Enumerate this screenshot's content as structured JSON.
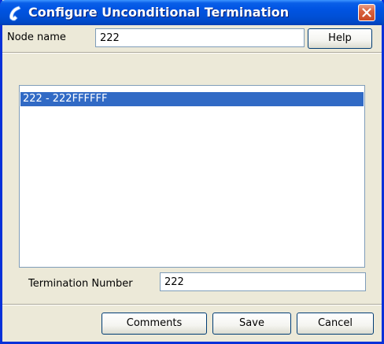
{
  "window": {
    "title": "Configure Unconditional Termination"
  },
  "node": {
    "label": "Node name",
    "value": "222",
    "help_label": "Help"
  },
  "list": {
    "items": [
      {
        "label": "222 - 222FFFFFF",
        "selected": true
      }
    ]
  },
  "termination": {
    "label": "Termination Number",
    "value": "222"
  },
  "buttons": {
    "comments": "Comments",
    "save": "Save",
    "cancel": "Cancel"
  },
  "colors": {
    "titlebar": "#0054e3",
    "selection": "#316ac5",
    "dialog_bg": "#ece9d8",
    "close": "#d9623e"
  },
  "icons": {
    "title": "phone-handset-icon",
    "close": "close-icon"
  }
}
